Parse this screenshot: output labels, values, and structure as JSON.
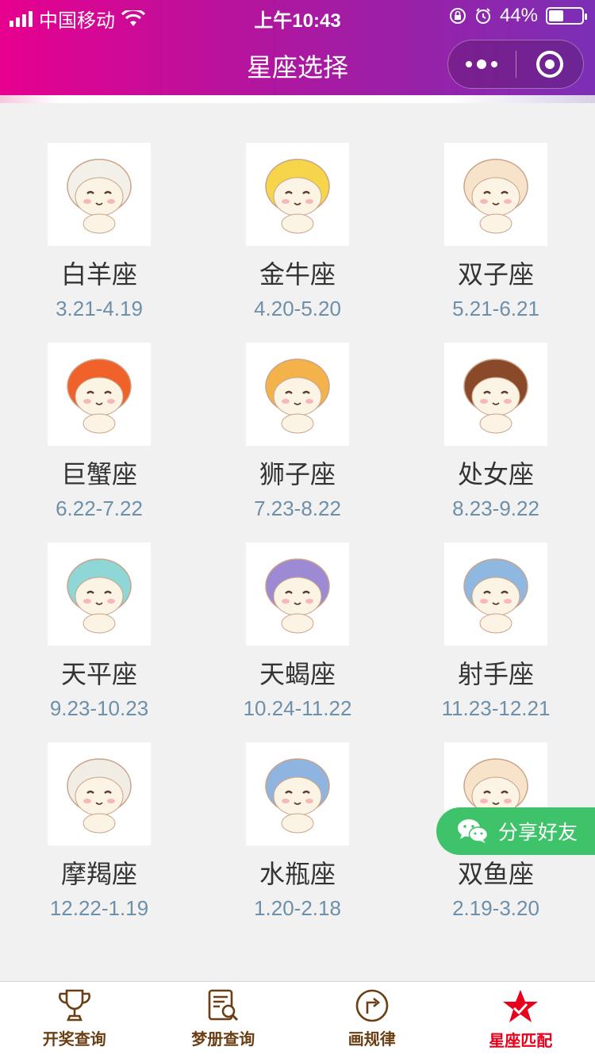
{
  "status_bar": {
    "carrier": "中国移动",
    "time": "上午10:43",
    "battery": "44%",
    "battery_level": 0.44
  },
  "nav": {
    "title": "星座选择"
  },
  "zodiac_signs": [
    {
      "name": "白羊座",
      "dates": "3.21-4.19",
      "icon": "aries-cat-icon",
      "color": "#f3f0ea"
    },
    {
      "name": "金牛座",
      "dates": "4.20-5.20",
      "icon": "taurus-cat-icon",
      "color": "#f6d54a"
    },
    {
      "name": "双子座",
      "dates": "5.21-6.21",
      "icon": "gemini-cats-icon",
      "color": "#f6e3c9"
    },
    {
      "name": "巨蟹座",
      "dates": "6.22-7.22",
      "icon": "cancer-cat-icon",
      "color": "#f0622a"
    },
    {
      "name": "狮子座",
      "dates": "7.23-8.22",
      "icon": "leo-cat-icon",
      "color": "#f4b24a"
    },
    {
      "name": "处女座",
      "dates": "8.23-9.22",
      "icon": "virgo-cat-icon",
      "color": "#8a4a2a"
    },
    {
      "name": "天平座",
      "dates": "9.23-10.23",
      "icon": "libra-cat-icon",
      "color": "#8fd6d6"
    },
    {
      "name": "天蝎座",
      "dates": "10.24-11.22",
      "icon": "scorpio-cat-icon",
      "color": "#9d8ad4"
    },
    {
      "name": "射手座",
      "dates": "11.23-12.21",
      "icon": "sagittarius-cat-icon",
      "color": "#8fb8e0"
    },
    {
      "name": "摩羯座",
      "dates": "12.22-1.19",
      "icon": "capricorn-cat-icon",
      "color": "#f1ede5"
    },
    {
      "name": "水瓶座",
      "dates": "1.20-2.18",
      "icon": "aquarius-cat-icon",
      "color": "#8fb4e0"
    },
    {
      "name": "双鱼座",
      "dates": "2.19-3.20",
      "icon": "pisces-cats-icon",
      "color": "#f6e3c9"
    }
  ],
  "share_button": {
    "label": "分享好友",
    "icon": "wechat-icon",
    "color": "#3ec36a"
  },
  "tabs": [
    {
      "label": "开奖查询",
      "icon": "trophy-icon",
      "active": false
    },
    {
      "label": "梦册查询",
      "icon": "document-search-icon",
      "active": false
    },
    {
      "label": "画规律",
      "icon": "arrow-circle-icon",
      "active": false
    },
    {
      "label": "星座匹配",
      "icon": "star-icon",
      "active": true
    }
  ],
  "colors": {
    "accent_start": "#e8008f",
    "accent_end": "#7b2fb5",
    "tab_text": "#6b3e14",
    "tab_active": "#e8001c",
    "date_text": "#6e8fa8"
  }
}
